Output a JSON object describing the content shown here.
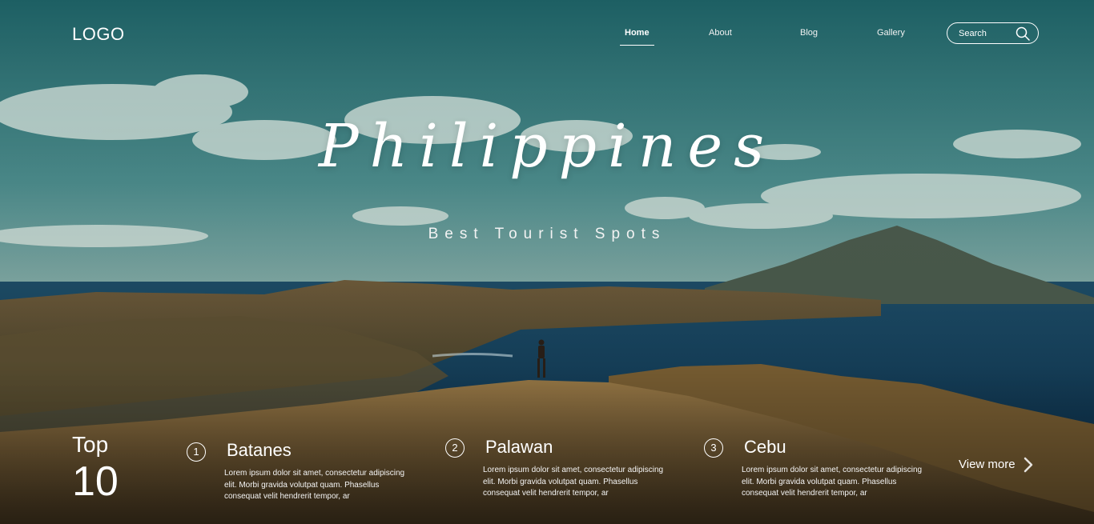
{
  "header": {
    "logo": "LOGO",
    "nav": [
      {
        "label": "Home",
        "active": true
      },
      {
        "label": "About",
        "active": false
      },
      {
        "label": "Blog",
        "active": false
      },
      {
        "label": "Gallery",
        "active": false
      }
    ],
    "search": {
      "placeholder": "Search",
      "icon": "search-icon"
    }
  },
  "hero": {
    "title": "Philippines",
    "subtitle": "Best Tourist Spots"
  },
  "top10": {
    "label": "Top",
    "number": "10"
  },
  "spots": [
    {
      "number": "1",
      "name": "Batanes",
      "description": "Lorem ipsum dolor sit amet, consectetur adipiscing elit. Morbi gravida volutpat quam. Phasellus consequat velit  hendrerit tempor, ar"
    },
    {
      "number": "2",
      "name": "Palawan",
      "description": "Lorem ipsum dolor sit amet, consectetur adipiscing elit. Morbi gravida volutpat quam. Phasellus consequat velit  hendrerit tempor, ar"
    },
    {
      "number": "3",
      "name": "Cebu",
      "description": "Lorem ipsum dolor sit amet, consectetur adipiscing elit. Morbi gravida volutpat quam. Phasellus consequat velit  hendrerit tempor, ar"
    }
  ],
  "view_more": {
    "label": "View more",
    "icon": "chevron-right-icon"
  },
  "colors": {
    "sky": "#3f7d7f",
    "sea": "#173f5a",
    "hill": "#8a6a3a",
    "text": "#ffffff"
  }
}
